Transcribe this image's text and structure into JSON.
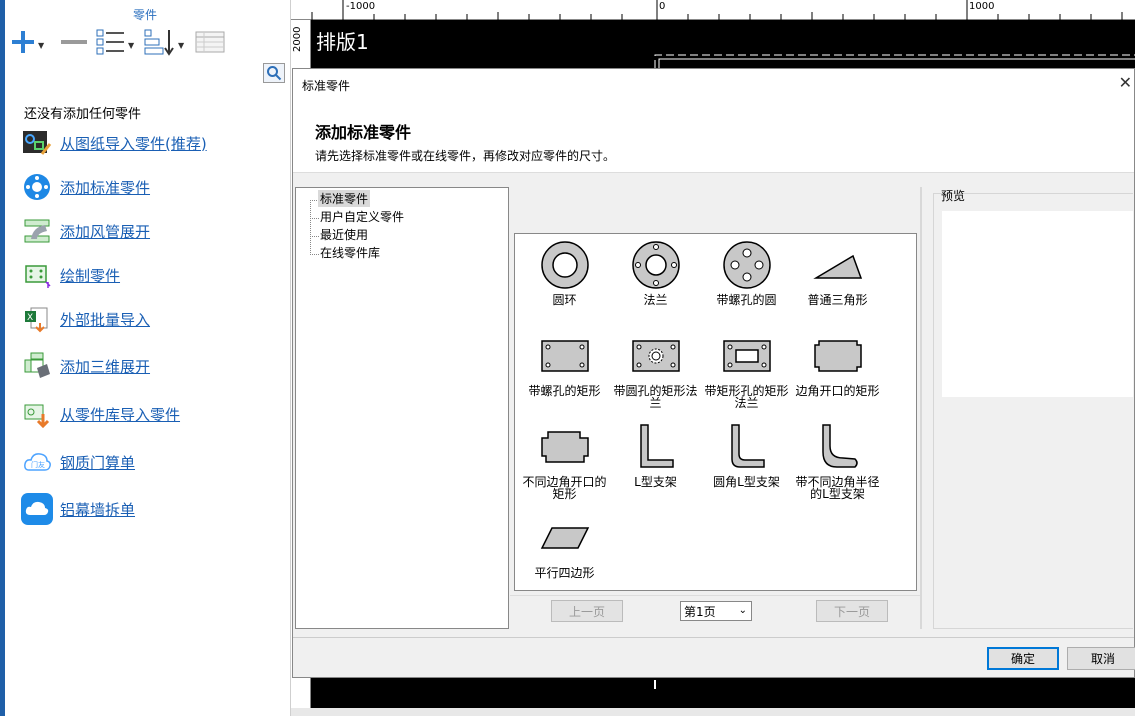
{
  "left_panel": {
    "title": "零件",
    "empty_message": "还没有添加任何零件",
    "actions": [
      {
        "label": "从图纸导入零件(推荐)",
        "icon": "import-drawing-icon"
      },
      {
        "label": "添加标准零件",
        "icon": "standard-part-icon"
      },
      {
        "label": "添加风管展开",
        "icon": "duct-unfold-icon"
      },
      {
        "label": "绘制零件",
        "icon": "draw-part-icon"
      },
      {
        "label": "外部批量导入",
        "icon": "excel-import-icon"
      },
      {
        "label": "添加三维展开",
        "icon": "3d-unfold-icon"
      },
      {
        "label": "从零件库导入零件",
        "icon": "library-import-icon"
      },
      {
        "label": "钢质门算单",
        "icon": "steel-door-icon"
      },
      {
        "label": "铝幕墙拆单",
        "icon": "aluminum-curtain-icon"
      }
    ]
  },
  "canvas": {
    "sheet_title": "排版1",
    "ruler_top": [
      "-1000",
      "0",
      "1000"
    ],
    "ruler_left": "2000"
  },
  "dialog": {
    "title": "标准零件",
    "heading": "添加标准零件",
    "subtext": "请先选择标准零件或在线零件，再修改对应零件的尺寸。",
    "tree": [
      "标准零件",
      "用户自定义零件",
      "最近使用",
      "在线零件库"
    ],
    "parts": [
      [
        "圆环"
      ],
      [
        "法兰"
      ],
      [
        "带螺孔的圆"
      ],
      [
        "普通三角形"
      ],
      [
        "带螺孔的矩形"
      ],
      [
        "带圆孔的矩形法",
        "兰"
      ],
      [
        "带矩形孔的矩形",
        "法兰"
      ],
      [
        "边角开口的矩形"
      ],
      [
        "不同边角开口的",
        "矩形"
      ],
      [
        "L型支架"
      ],
      [
        "圆角L型支架"
      ],
      [
        "带不同边角半径",
        "的L型支架"
      ],
      [
        "平行四边形"
      ]
    ],
    "pager": {
      "prev": "上一页",
      "page": "第1页",
      "next": "下一页"
    },
    "preview_label": "预览",
    "ok": "确定",
    "cancel": "取消"
  }
}
